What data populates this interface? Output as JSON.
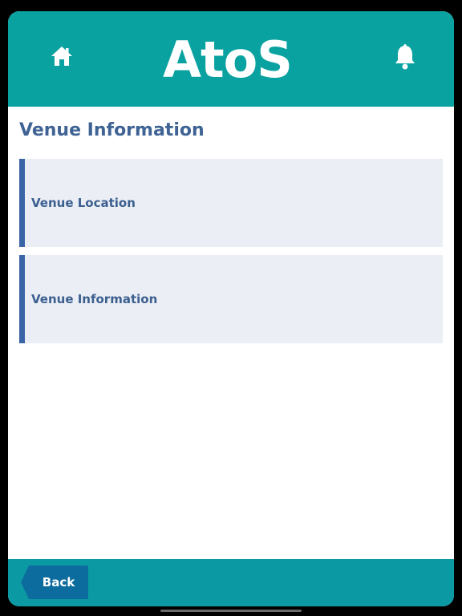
{
  "header": {
    "logo_text": "AtoS",
    "home_icon": "home-icon",
    "bell_icon": "bell-icon",
    "brand_color": "#0aa2a0"
  },
  "page": {
    "title": "Venue Information"
  },
  "cards": [
    {
      "label": "Venue Location"
    },
    {
      "label": "Venue Information"
    }
  ],
  "footer": {
    "back_label": "Back",
    "back_color": "#0d6c9e"
  }
}
